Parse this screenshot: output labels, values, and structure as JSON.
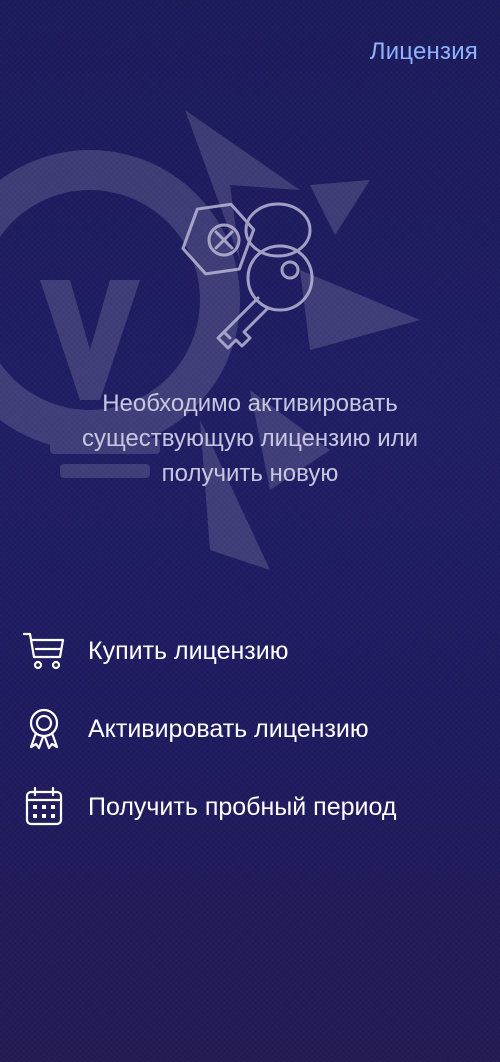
{
  "header": {
    "license_link": "Лицензия"
  },
  "main": {
    "message": "Необходимо активировать существующую лицензию или получить новую"
  },
  "actions": [
    {
      "label": "Купить лицензию",
      "icon": "cart-icon"
    },
    {
      "label": "Активировать лицензию",
      "icon": "award-icon"
    },
    {
      "label": "Получить пробный период",
      "icon": "calendar-icon"
    }
  ],
  "colors": {
    "background_top": "#1b1a5a",
    "background_bottom": "#231a52",
    "link": "#8fb3ff",
    "message_text": "#c7c7df"
  }
}
